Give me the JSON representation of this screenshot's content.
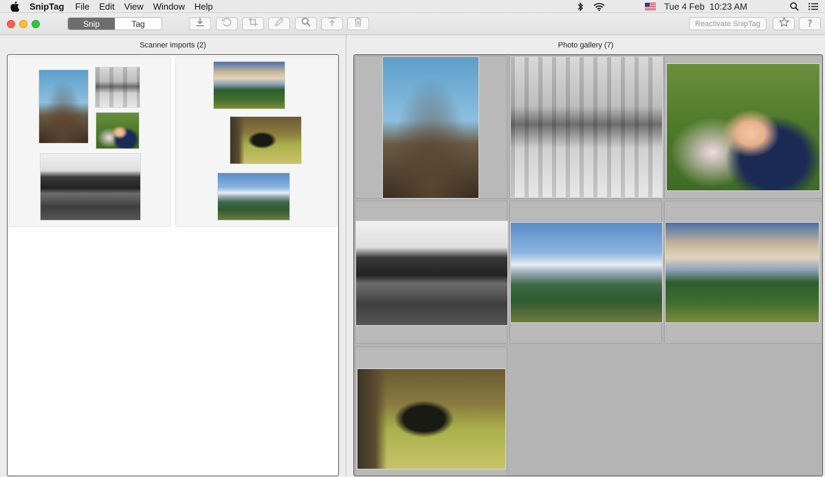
{
  "menubar": {
    "app_name": "SnipTag",
    "items": [
      "File",
      "Edit",
      "View",
      "Window",
      "Help"
    ],
    "clock": "Tue 4 Feb  10:23 AM"
  },
  "toolbar": {
    "segments": [
      "Snip",
      "Tag"
    ],
    "active_segment": "Snip",
    "buttons": [
      "import-icon",
      "undo-icon",
      "crop-icon",
      "pencil-icon",
      "search-icon",
      "export-icon",
      "trash-icon"
    ],
    "reactivate_label": "Reactivate SnipTag"
  },
  "left_pane": {
    "title": "Scanner imports (2)",
    "cards": [
      {
        "photos": [
          "clock tower",
          "old street",
          "grandfather hug",
          "train depot"
        ]
      },
      {
        "photos": [
          "mountain river",
          "moose",
          "teton range"
        ]
      }
    ]
  },
  "right_pane": {
    "title": "Photo gallery (7)",
    "photos": [
      "clock tower",
      "old street",
      "grandfather hug",
      "train depot",
      "teton range",
      "mountain river",
      "moose"
    ]
  },
  "colors": {
    "close": "#fc5f57",
    "minimize": "#fdbc2e",
    "maximize": "#28c840",
    "segment_active": "#6d6d6d",
    "gallery_bg": "#b4b4b4"
  }
}
